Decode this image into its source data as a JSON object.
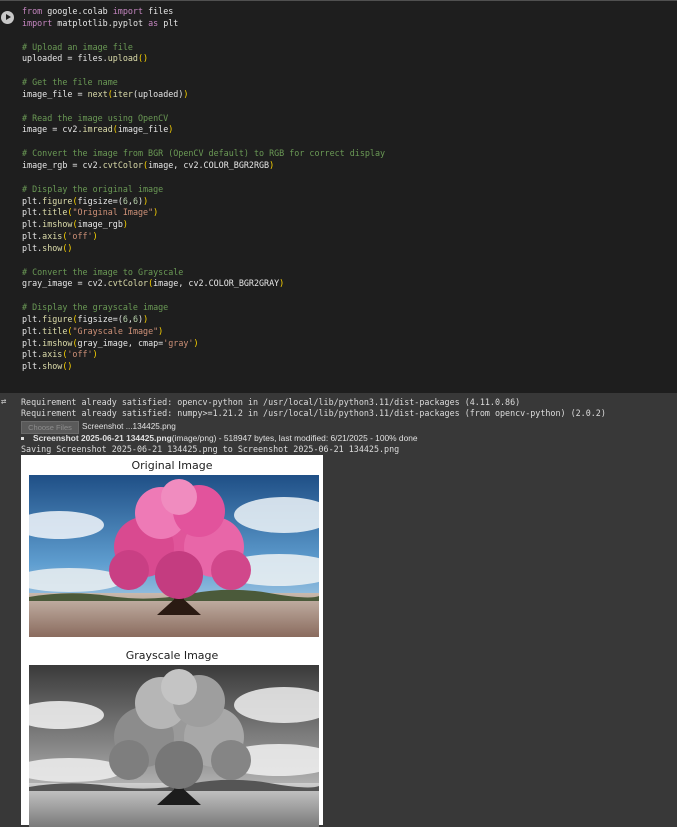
{
  "code_cell": {
    "lines": [
      [
        {
          "t": "from",
          "c": "kw"
        },
        {
          "t": " google.colab "
        },
        {
          "t": "import",
          "c": "kw"
        },
        {
          "t": " files"
        }
      ],
      [
        {
          "t": "import",
          "c": "kw"
        },
        {
          "t": " matplotlib.pyplot "
        },
        {
          "t": "as",
          "c": "kw"
        },
        {
          "t": " plt"
        }
      ],
      [],
      [
        {
          "t": "# Upload an image file",
          "c": "cm"
        }
      ],
      [
        {
          "t": "uploaded = files."
        },
        {
          "t": "upload",
          "c": "fn"
        },
        {
          "t": "()",
          "c": "pr"
        }
      ],
      [],
      [
        {
          "t": "# Get the file name",
          "c": "cm"
        }
      ],
      [
        {
          "t": "image_file = "
        },
        {
          "t": "next",
          "c": "fn"
        },
        {
          "t": "(",
          "c": "pr"
        },
        {
          "t": "iter",
          "c": "fn"
        },
        {
          "t": "(uploaded)"
        },
        {
          "t": ")",
          "c": "pr"
        }
      ],
      [],
      [
        {
          "t": "# Read the image using OpenCV",
          "c": "cm"
        }
      ],
      [
        {
          "t": "image = cv2."
        },
        {
          "t": "imread",
          "c": "fn"
        },
        {
          "t": "(",
          "c": "pr"
        },
        {
          "t": "image_file"
        },
        {
          "t": ")",
          "c": "pr"
        }
      ],
      [],
      [
        {
          "t": "# Convert the image from BGR (OpenCV default) to RGB for correct display",
          "c": "cm"
        }
      ],
      [
        {
          "t": "image_rgb = cv2."
        },
        {
          "t": "cvtColor",
          "c": "fn"
        },
        {
          "t": "(",
          "c": "pr"
        },
        {
          "t": "image, cv2.COLOR_BGR2RGB"
        },
        {
          "t": ")",
          "c": "pr"
        }
      ],
      [],
      [
        {
          "t": "# Display the original image",
          "c": "cm"
        }
      ],
      [
        {
          "t": "plt."
        },
        {
          "t": "figure",
          "c": "fn"
        },
        {
          "t": "(",
          "c": "pr"
        },
        {
          "t": "figsize=("
        },
        {
          "t": "6",
          "c": "nm"
        },
        {
          "t": ","
        },
        {
          "t": "6",
          "c": "nm"
        },
        {
          "t": ")"
        },
        {
          "t": ")",
          "c": "pr"
        }
      ],
      [
        {
          "t": "plt."
        },
        {
          "t": "title",
          "c": "fn"
        },
        {
          "t": "(",
          "c": "pr"
        },
        {
          "t": "\"Original Image\"",
          "c": "st"
        },
        {
          "t": ")",
          "c": "pr"
        }
      ],
      [
        {
          "t": "plt."
        },
        {
          "t": "imshow",
          "c": "fn"
        },
        {
          "t": "(",
          "c": "pr"
        },
        {
          "t": "image_rgb"
        },
        {
          "t": ")",
          "c": "pr"
        }
      ],
      [
        {
          "t": "plt."
        },
        {
          "t": "axis",
          "c": "fn"
        },
        {
          "t": "(",
          "c": "pr"
        },
        {
          "t": "'off'",
          "c": "st"
        },
        {
          "t": ")",
          "c": "pr"
        }
      ],
      [
        {
          "t": "plt."
        },
        {
          "t": "show",
          "c": "fn"
        },
        {
          "t": "()",
          "c": "pr"
        }
      ],
      [],
      [
        {
          "t": "# Convert the image to Grayscale",
          "c": "cm"
        }
      ],
      [
        {
          "t": "gray_image = cv2."
        },
        {
          "t": "cvtColor",
          "c": "fn"
        },
        {
          "t": "(",
          "c": "pr"
        },
        {
          "t": "image, cv2.COLOR_BGR2GRAY"
        },
        {
          "t": ")",
          "c": "pr"
        }
      ],
      [],
      [
        {
          "t": "# Display the grayscale image",
          "c": "cm"
        }
      ],
      [
        {
          "t": "plt."
        },
        {
          "t": "figure",
          "c": "fn"
        },
        {
          "t": "(",
          "c": "pr"
        },
        {
          "t": "figsize=("
        },
        {
          "t": "6",
          "c": "nm"
        },
        {
          "t": ","
        },
        {
          "t": "6",
          "c": "nm"
        },
        {
          "t": ")"
        },
        {
          "t": ")",
          "c": "pr"
        }
      ],
      [
        {
          "t": "plt."
        },
        {
          "t": "title",
          "c": "fn"
        },
        {
          "t": "(",
          "c": "pr"
        },
        {
          "t": "\"Grayscale Image\"",
          "c": "st"
        },
        {
          "t": ")",
          "c": "pr"
        }
      ],
      [
        {
          "t": "plt."
        },
        {
          "t": "imshow",
          "c": "fn"
        },
        {
          "t": "(",
          "c": "pr"
        },
        {
          "t": "gray_image, cmap="
        },
        {
          "t": "'gray'",
          "c": "st"
        },
        {
          "t": ")",
          "c": "pr"
        }
      ],
      [
        {
          "t": "plt."
        },
        {
          "t": "axis",
          "c": "fn"
        },
        {
          "t": "(",
          "c": "pr"
        },
        {
          "t": "'off'",
          "c": "st"
        },
        {
          "t": ")",
          "c": "pr"
        }
      ],
      [
        {
          "t": "plt."
        },
        {
          "t": "show",
          "c": "fn"
        },
        {
          "t": "()",
          "c": "pr"
        }
      ]
    ]
  },
  "output": {
    "req_line_1": "Requirement already satisfied: opencv-python in /usr/local/lib/python3.11/dist-packages (4.11.0.86)",
    "req_line_2": "Requirement already satisfied: numpy>=1.21.2 in /usr/local/lib/python3.11/dist-packages (from opencv-python) (2.0.2)",
    "choose_files_label": "Choose Files",
    "chosen_file_label": "Screenshot ...134425.png",
    "file_entry_name": "Screenshot 2025-06-21 134425.png",
    "file_entry_details": "(image/png) - 518947 bytes, last modified: 6/21/2025 - 100% done",
    "saving_line": "Saving Screenshot 2025-06-21 134425.png to Screenshot 2025-06-21 134425.png",
    "figure_1_title": "Original Image",
    "figure_2_title": "Grayscale Image"
  }
}
